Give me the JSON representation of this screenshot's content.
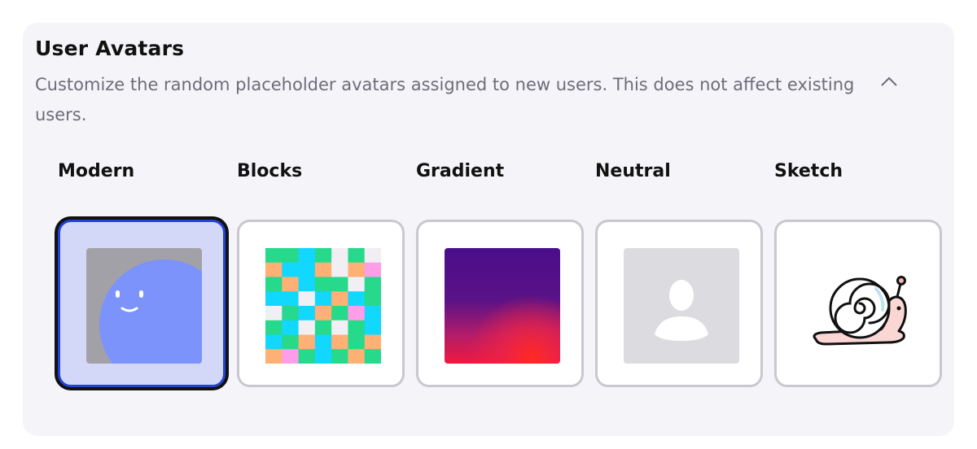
{
  "section": {
    "title": "User Avatars",
    "description": "Customize the random placeholder avatars assigned to new users. This does not affect existing users.",
    "collapse_icon": "chevron-up-icon"
  },
  "avatar_styles": [
    {
      "label": "Modern",
      "selected": true,
      "icon": "modern-avatar-icon"
    },
    {
      "label": "Blocks",
      "selected": false,
      "icon": "blocks-avatar-icon"
    },
    {
      "label": "Gradient",
      "selected": false,
      "icon": "gradient-avatar-icon"
    },
    {
      "label": "Neutral",
      "selected": false,
      "icon": "neutral-avatar-icon"
    },
    {
      "label": "Sketch",
      "selected": false,
      "icon": "snail-sketch-icon"
    }
  ],
  "colors": {
    "selected_border": "#2343d4",
    "selected_fill": "#d4d8f8",
    "modern_face": "#7b93fb",
    "modern_bg": "#a3a1a8"
  }
}
